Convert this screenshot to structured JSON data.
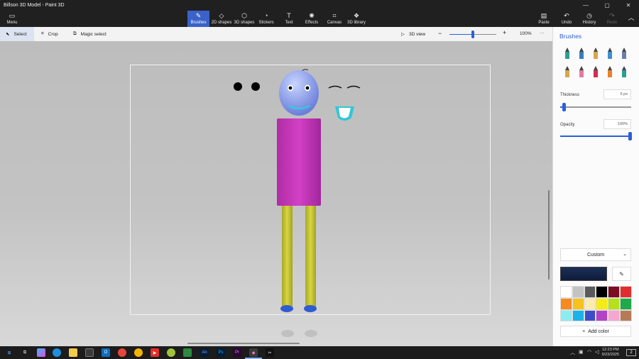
{
  "window": {
    "title": "Billson 3D Model - Paint 3D",
    "controls": {
      "minimize": "—",
      "maximize": "▢",
      "close": "✕"
    }
  },
  "ribbon": {
    "menu": {
      "label": "Menu",
      "icon": "folder-icon"
    },
    "tools": [
      {
        "label": "Brushes",
        "icon": "brush-icon",
        "active": true
      },
      {
        "label": "2D shapes",
        "icon": "2d-shapes-icon",
        "active": false
      },
      {
        "label": "3D shapes",
        "icon": "3d-shapes-icon",
        "active": false
      },
      {
        "label": "Stickers",
        "icon": "stickers-icon",
        "active": false
      },
      {
        "label": "Text",
        "icon": "text-icon",
        "active": false
      },
      {
        "label": "Effects",
        "icon": "effects-icon",
        "active": false
      },
      {
        "label": "Canvas",
        "icon": "canvas-icon",
        "active": false
      },
      {
        "label": "3D library",
        "icon": "3d-library-icon",
        "active": false
      }
    ],
    "right": [
      {
        "label": "Paste",
        "icon": "paste-icon",
        "enabled": true
      },
      {
        "label": "Undo",
        "icon": "undo-icon",
        "enabled": true
      },
      {
        "label": "History",
        "icon": "history-icon",
        "enabled": true
      },
      {
        "label": "Redo",
        "icon": "redo-icon",
        "enabled": false
      }
    ]
  },
  "toolbar": {
    "select": "Select",
    "crop": "Crop",
    "magic_select": "Magic select",
    "view_3d": "3D view",
    "zoom_minus": "−",
    "zoom_plus": "+",
    "zoom_level": "100%",
    "zoom_fraction": 0.5,
    "more": "···"
  },
  "brushes_panel": {
    "title": "Brushes",
    "brushes": [
      {
        "name": "marker",
        "color": "#2e9e8f"
      },
      {
        "name": "calligraphy-pen",
        "color": "#3a7bbf"
      },
      {
        "name": "oil-brush",
        "color": "#d9a64b"
      },
      {
        "name": "watercolor",
        "color": "#3d8fd6"
      },
      {
        "name": "pixel-pen",
        "color": "#6b7fa6"
      },
      {
        "name": "pencil",
        "color": "#d9a64b"
      },
      {
        "name": "eraser",
        "color": "#e27aa0"
      },
      {
        "name": "crayon",
        "color": "#d62b4f"
      },
      {
        "name": "spray-can",
        "color": "#e8822b"
      },
      {
        "name": "fill",
        "color": "#2e9e8f"
      }
    ],
    "thickness_label": "Thickness",
    "thickness_value": "5 px",
    "thickness_fraction": 0.05,
    "opacity_label": "Opacity",
    "opacity_value": "100%",
    "opacity_fraction": 1.0,
    "color_mode": "Custom",
    "current_color": "#1b2f56",
    "palette": [
      "#ffffff",
      "#c3c3c3",
      "#5a5a5a",
      "#000000",
      "#7a0f24",
      "#e12d2d",
      "#f78a1f",
      "#f6c21b",
      "#fdebad",
      "#f5ec15",
      "#b6e01b",
      "#1fa94b",
      "#8cecf0",
      "#1ab2e8",
      "#3d4cc8",
      "#b342c6",
      "#f7a6d1",
      "#b77a57"
    ],
    "add_color": "Add color"
  },
  "taskbar": {
    "apps": [
      "start-icon",
      "task-view-icon",
      "copilot-icon",
      "edge-icon",
      "file-explorer-icon",
      "store-icon",
      "outlook-icon",
      "chrome-icon",
      "chrome-icon",
      "xbox-icon",
      "solitaire-icon",
      "animate-icon",
      "photoshop-icon",
      "premiere-icon",
      "paint3d-icon",
      "capcut-icon"
    ],
    "time": "12:23 PM",
    "date": "9/23/2025",
    "notification_count": "2"
  }
}
